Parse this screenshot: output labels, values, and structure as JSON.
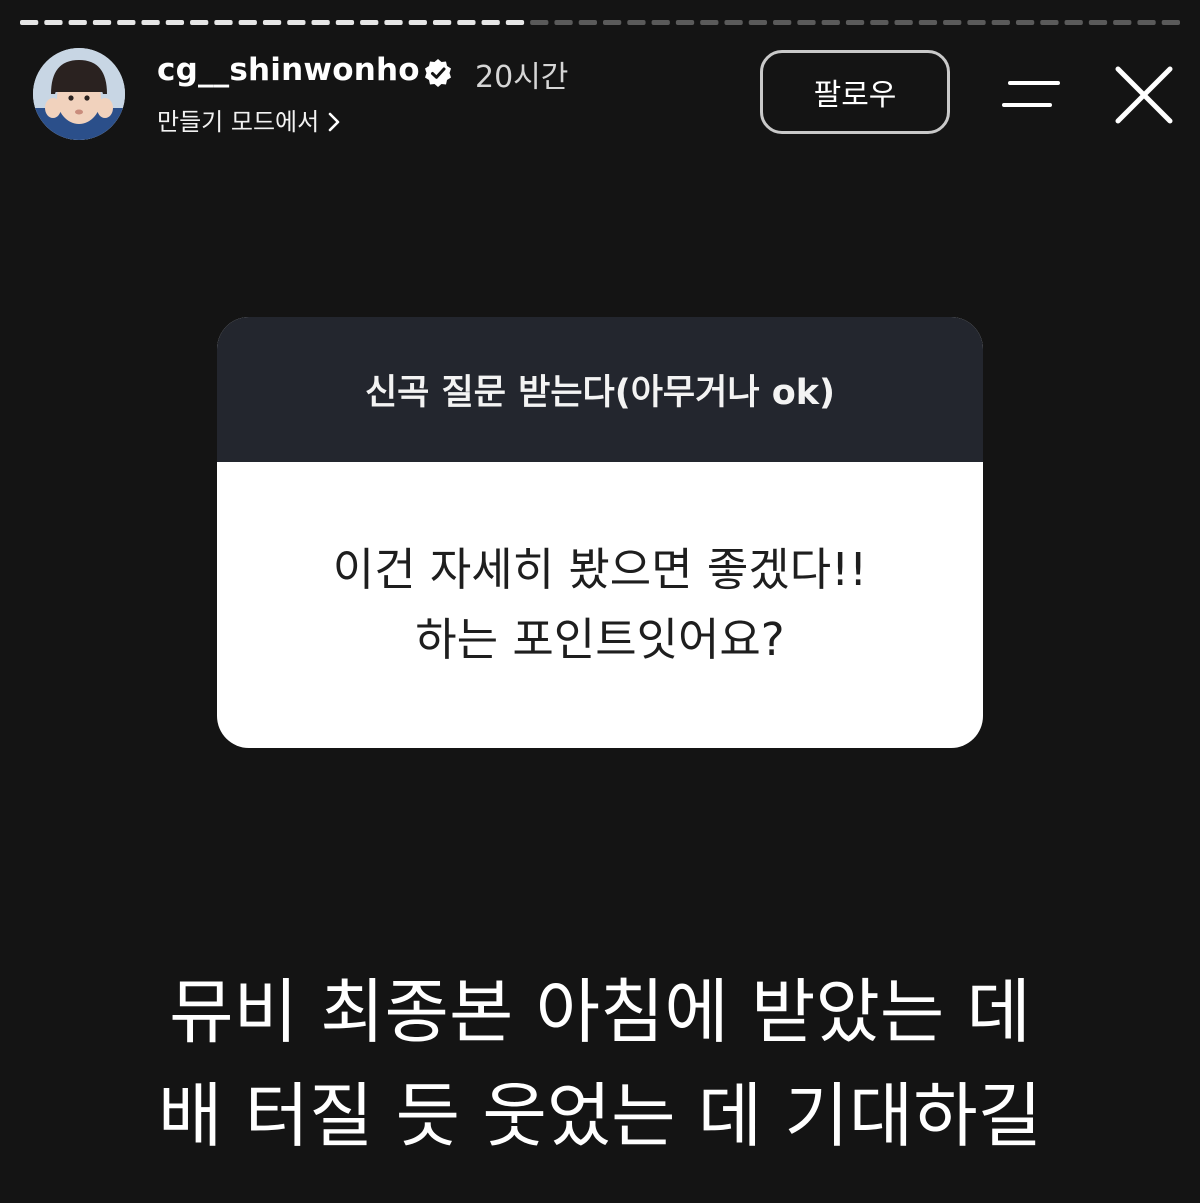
{
  "story": {
    "segments_total": 48,
    "segments_seen": 21,
    "username": "cg__shinwonho",
    "time_ago": "20시간",
    "subtitle": "만들기 모드에서",
    "follow_label": "팔로우"
  },
  "icons": {
    "verified": "verified-badge-icon",
    "chevron": "chevron-right-icon",
    "menu": "menu-icon",
    "close": "close-icon"
  },
  "question_sticker": {
    "prompt": "신곡 질문 받는다(아무거나 ok)",
    "answer_line1": "이건 자세히 봤으면 좋겠다!!",
    "answer_line2": "하는 포인트잇어요?"
  },
  "caption": {
    "line1": "뮤비 최종본 아침에 받았는 데",
    "line2": "배 터질 듯 웃었는 데 기대하길"
  },
  "colors": {
    "background": "#141414",
    "sticker_header": "#23262e",
    "progress_seen": "#e6e6e6",
    "progress_unseen": "#5a5a5a"
  }
}
